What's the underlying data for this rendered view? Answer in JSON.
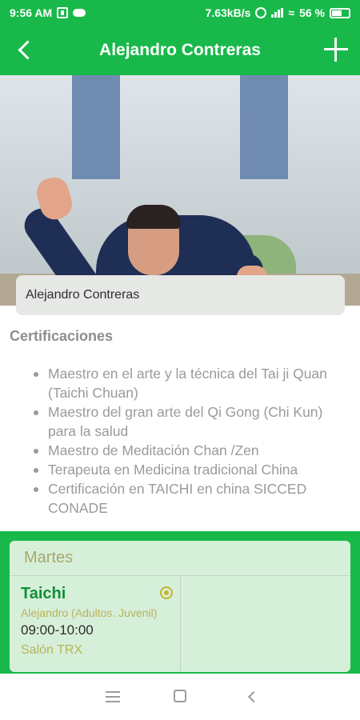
{
  "status_bar": {
    "time": "9:56 AM",
    "speed": "7.63kB/s",
    "battery": "56 %"
  },
  "app_bar": {
    "title": "Alejandro Contreras"
  },
  "profile": {
    "name_value": "Alejandro Contreras"
  },
  "certifications": {
    "heading": "Certificaciones",
    "items": [
      "Maestro en el arte y la técnica del Tai ji Quan (Taichi Chuan)",
      "Maestro del gran arte del Qi Gong (Chi Kun) para la salud",
      "Maestro de Meditación Chan /Zen",
      "Terapeuta en Medicina tradicional China",
      "Certificación en TAICHI en china SICCED CONADE"
    ]
  },
  "schedule": {
    "day": "Martes",
    "class": {
      "name": "Taichi",
      "instructor": "Alejandro (Adultos. Juvenil)",
      "time": "09:00-10:00",
      "room": "Salón TRX"
    }
  },
  "colors": {
    "brand_green": "#18b94a",
    "card_green": "#d6efd9",
    "class_green": "#0e8f37",
    "olive": "#b8b35a"
  },
  "icons": [
    "back-icon",
    "add-icon",
    "check-circle-icon",
    "menu-icon",
    "home-icon",
    "nav-back-icon"
  ]
}
